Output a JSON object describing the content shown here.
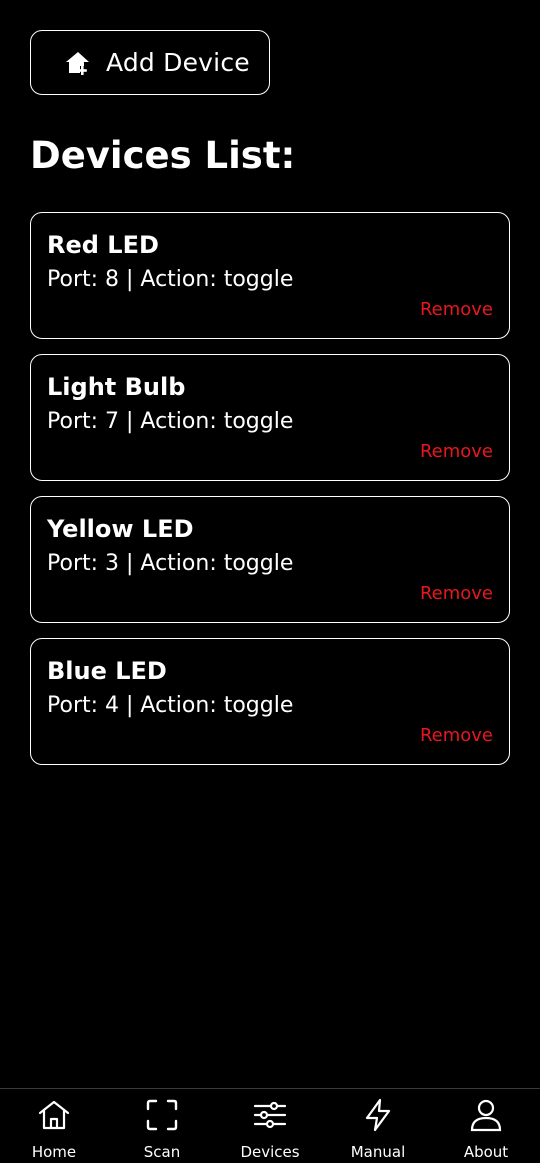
{
  "add_device": {
    "label": "Add Device",
    "icon": "home-add-icon"
  },
  "title": "Devices List:",
  "devices": [
    {
      "name": "Red LED",
      "meta": "Port: 8 | Action: toggle",
      "remove_label": "Remove"
    },
    {
      "name": "Light Bulb",
      "meta": "Port: 7 | Action: toggle",
      "remove_label": "Remove"
    },
    {
      "name": "Yellow LED",
      "meta": "Port: 3 | Action: toggle",
      "remove_label": "Remove"
    },
    {
      "name": "Blue LED",
      "meta": "Port: 4 | Action: toggle",
      "remove_label": "Remove"
    }
  ],
  "nav": [
    {
      "label": "Home",
      "icon": "home-icon"
    },
    {
      "label": "Scan",
      "icon": "scan-icon"
    },
    {
      "label": "Devices",
      "icon": "sliders-icon"
    },
    {
      "label": "Manual",
      "icon": "lightning-icon"
    },
    {
      "label": "About",
      "icon": "person-icon"
    }
  ],
  "colors": {
    "background": "#000000",
    "text": "#ffffff",
    "remove": "#e8171f",
    "border": "#ffffff"
  }
}
